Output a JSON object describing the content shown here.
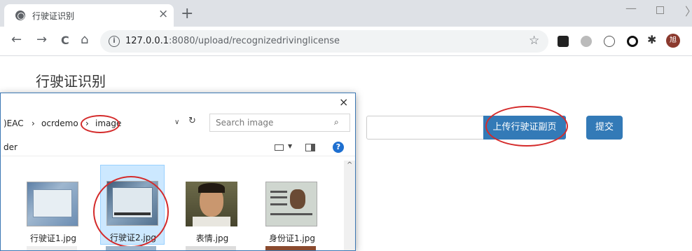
{
  "browser": {
    "tab_title": "行驶证识别",
    "tab_close": "×",
    "new_tab": "+",
    "window_min": "—",
    "window_close": "〉",
    "back": "←",
    "forward": "→",
    "reload": "C",
    "home": "⌂",
    "info": "i",
    "url_host": "127.0.0.1",
    "url_path": ":8080/upload/recognizedrivinglicense",
    "bookmark_star": "☆",
    "profile_initial": "旭"
  },
  "page": {
    "title": "行驶证识别",
    "upload_button": "上传行驶证副页",
    "submit_button": "提交"
  },
  "dialog": {
    "close": "×",
    "breadcrumb_root": ")EAC",
    "breadcrumb_sep1": "›",
    "breadcrumb_folder1": "ocrdemo",
    "breadcrumb_sep2": "›",
    "breadcrumb_folder2": "image",
    "addr_dropdown": "∨",
    "addr_refresh": "↻",
    "search_placeholder": "Search image",
    "search_icon": "⌕",
    "cmdbar_label": "der",
    "view_dropdown": "▼",
    "help": "?",
    "scroll_up": "^",
    "files": [
      {
        "name": "行驶证1.jpg",
        "selected": false
      },
      {
        "name": "行驶证2.jpg",
        "selected": true
      },
      {
        "name": "表情.jpg",
        "selected": false
      },
      {
        "name": "身份证1.jpg",
        "selected": false
      }
    ]
  },
  "colors": {
    "primary_button": "#337ab7",
    "annotation_red": "#d42b2b",
    "selection": "#cce8ff"
  }
}
